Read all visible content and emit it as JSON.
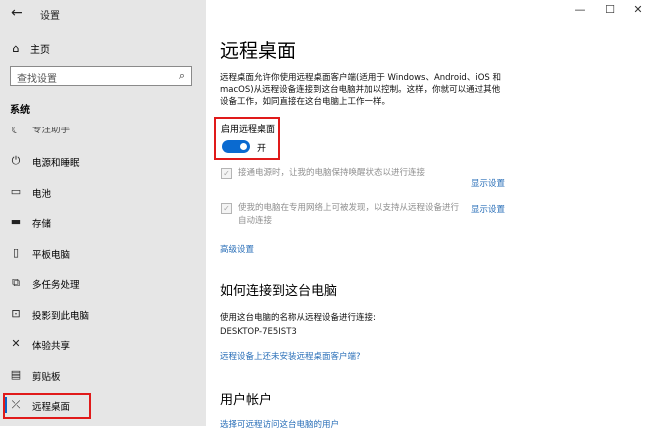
{
  "window": {
    "title": "设置",
    "back_glyph": "←",
    "minimize_glyph": "—",
    "maximize_glyph": "☐",
    "close_glyph": "✕"
  },
  "sidebar": {
    "home": {
      "label": "主页",
      "icon": "home-icon",
      "glyph": "⌂"
    },
    "search": {
      "placeholder": "查找设置",
      "icon": "search-icon",
      "glyph": "⌕"
    },
    "section_label": "系统",
    "items": [
      {
        "label": "专注助手",
        "icon": "focus-assist-icon",
        "glyph": "☾"
      },
      {
        "label": "电源和睡眠",
        "icon": "power-icon",
        "glyph": "⏻"
      },
      {
        "label": "电池",
        "icon": "battery-icon",
        "glyph": "▭"
      },
      {
        "label": "存储",
        "icon": "storage-icon",
        "glyph": "▬"
      },
      {
        "label": "平板电脑",
        "icon": "tablet-icon",
        "glyph": "▯"
      },
      {
        "label": "多任务处理",
        "icon": "multitasking-icon",
        "glyph": "⧉"
      },
      {
        "label": "投影到此电脑",
        "icon": "projecting-icon",
        "glyph": "⊡"
      },
      {
        "label": "体验共享",
        "icon": "shared-experiences-icon",
        "glyph": "✕"
      },
      {
        "label": "剪贴板",
        "icon": "clipboard-icon",
        "glyph": "▤"
      },
      {
        "label": "远程桌面",
        "icon": "remote-desktop-icon",
        "glyph": "⤫"
      }
    ]
  },
  "main": {
    "title": "远程桌面",
    "description": "远程桌面允许你使用远程桌面客户端(适用于 Windows、Android、iOS 和 macOS)从远程设备连接到这台电脑并加以控制。这样，你就可以通过其他设备工作，如同直接在这台电脑上工作一样。",
    "enable_label": "启用远程桌面",
    "toggle_state": "开",
    "toggle_on": true,
    "option1": {
      "text": "接通电源时，让我的电脑保持唤醒状态以进行连接",
      "link": "显示设置",
      "checked": true
    },
    "option2": {
      "text": "使我的电脑在专用网络上可被发现，以支持从远程设备进行自动连接",
      "link": "显示设置",
      "checked": true
    },
    "advanced_link": "高级设置",
    "how_to_connect": {
      "heading": "如何连接到这台电脑",
      "instruction": "使用这台电脑的名称从远程设备进行连接:",
      "pc_name": "DESKTOP-7E5IST3",
      "no_client_link": "远程设备上还未安装远程桌面客户端?"
    },
    "user_accounts": {
      "heading": "用户帐户",
      "select_users_link": "选择可远程访问这台电脑的用户"
    }
  },
  "colors": {
    "sidebar_bg": "#e6e6e6",
    "accent": "#0a6ad0",
    "link": "#2a6fb8",
    "highlight_border": "#e01a1a"
  }
}
